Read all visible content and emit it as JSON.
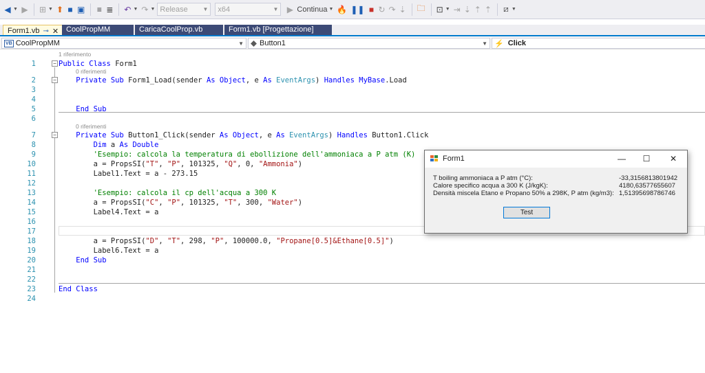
{
  "toolbar": {
    "config_combo": "Release",
    "platform_combo": "x64",
    "continue_label": "Continua"
  },
  "tabs": [
    {
      "label": "Form1.vb",
      "active": true
    },
    {
      "label": "CoolPropMM",
      "active": false
    },
    {
      "label": "CaricaCoolProp.vb",
      "active": false
    },
    {
      "label": "Form1.vb [Progettazione]",
      "active": false
    }
  ],
  "navbar": {
    "project": "CoolPropMM",
    "object": "Button1",
    "event": "Click"
  },
  "code_lens": {
    "class_refs": "1 riferimento",
    "load_refs": "0 riferimenti",
    "click_refs": "0 riferimenti"
  },
  "code": {
    "l1_kw": "Public Class ",
    "l1_name": "Form1",
    "l2_a": "    Private Sub ",
    "l2_b": "Form1_Load(sender ",
    "l2_as1": "As ",
    "l2_obj": "Object",
    "l2_c": ", e ",
    "l2_as2": "As ",
    "l2_ev": "EventArgs",
    "l2_d": ") ",
    "l2_handles": "Handles ",
    "l2_mybase": "MyBase",
    "l2_e": ".Load",
    "l5_kw": "    End Sub",
    "l7_a": "    Private Sub ",
    "l7_b": "Button1_Click(sender ",
    "l7_as1": "As ",
    "l7_obj": "Object",
    "l7_c": ", e ",
    "l7_as2": "As ",
    "l7_ev": "EventArgs",
    "l7_d": ") ",
    "l7_handles": "Handles ",
    "l7_e": "Button1.Click",
    "l8_kw": "        Dim ",
    "l8_a": "a ",
    "l8_as": "As Double",
    "l9_cm": "        'Esempio: calcola la temperatura di ebollizione dell'ammoniaca a P atm (K)",
    "l10_a": "        a = PropsSI(",
    "l10_s1": "\"T\"",
    "l10_b": ", ",
    "l10_s2": "\"P\"",
    "l10_c": ", 101325, ",
    "l10_s3": "\"Q\"",
    "l10_d": ", 0, ",
    "l10_s4": "\"Ammonia\"",
    "l10_e": ")",
    "l11": "        Label1.Text = a - 273.15",
    "l13_cm": "        'Esempio: calcola il cp dell'acqua a 300 K",
    "l14_a": "        a = PropsSI(",
    "l14_s1": "\"C\"",
    "l14_b": ", ",
    "l14_s2": "\"P\"",
    "l14_c": ", 101325, ",
    "l14_s3": "\"T\"",
    "l14_d": ", 300, ",
    "l14_s4": "\"Water\"",
    "l14_e": ")",
    "l15": "        Label4.Text = a",
    "l18_a": "        a = PropsSI(",
    "l18_s1": "\"D\"",
    "l18_b": ", ",
    "l18_s2": "\"T\"",
    "l18_c": ", 298, ",
    "l18_s3": "\"P\"",
    "l18_d": ", 100000.0, ",
    "l18_s4": "\"Propane[0.5]&Ethane[0.5]\"",
    "l18_e": ")",
    "l19": "        Label6.Text = a",
    "l20_kw": "    End Sub",
    "l23_kw": "End Class"
  },
  "line_numbers": [
    "1",
    "2",
    "3",
    "4",
    "5",
    "6",
    "7",
    "8",
    "9",
    "10",
    "11",
    "12",
    "13",
    "14",
    "15",
    "16",
    "17",
    "18",
    "19",
    "20",
    "21",
    "22",
    "23",
    "24"
  ],
  "form": {
    "title": "Form1",
    "minimize": "—",
    "maximize": "☐",
    "close": "✕",
    "rows": [
      {
        "label": "T boiling ammoniaca a P atm (°C):",
        "value": "-33,3156813801942"
      },
      {
        "label": "Calore specifico acqua a 300 K (J/kgK):",
        "value": "4180,63577655607"
      },
      {
        "label": "Densità miscela Etano e Propano 50% a 298K,  P atm (kg/m3):",
        "value": "1,51395698786746"
      }
    ],
    "button": "Test"
  },
  "colors": {
    "keyword": "#0000ff",
    "type": "#2b91af",
    "string": "#a31515",
    "comment": "#008000",
    "tab_inactive": "#3c4a76",
    "accent": "#007acc"
  }
}
